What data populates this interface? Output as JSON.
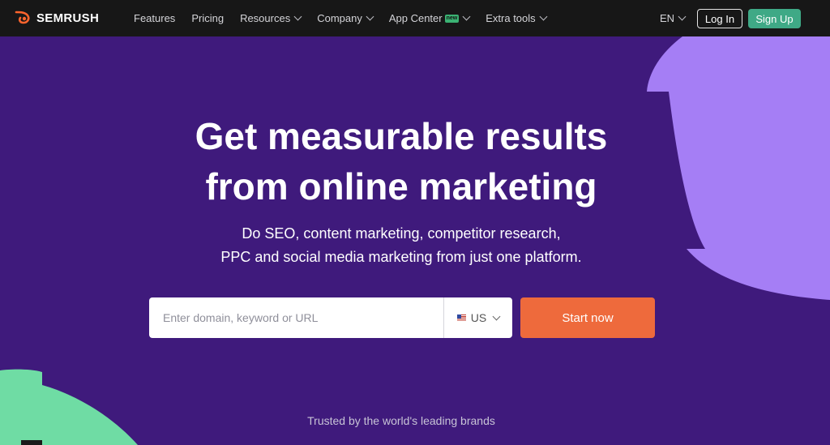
{
  "brand": {
    "name": "SEMRUSH",
    "accent": "#ff642d"
  },
  "nav": {
    "items": [
      {
        "label": "Features",
        "dropdown": false
      },
      {
        "label": "Pricing",
        "dropdown": false
      },
      {
        "label": "Resources",
        "dropdown": true
      },
      {
        "label": "Company",
        "dropdown": true
      },
      {
        "label": "App Center",
        "dropdown": true,
        "badge": "new"
      },
      {
        "label": "Extra tools",
        "dropdown": true
      }
    ],
    "language": "EN",
    "login_label": "Log In",
    "signup_label": "Sign Up"
  },
  "hero": {
    "headline_line1": "Get measurable results",
    "headline_line2": "from online marketing",
    "subhead_line1": "Do SEO, content marketing, competitor research,",
    "subhead_line2": "PPC and social media marketing from just one platform.",
    "search_placeholder": "Enter domain, keyword or URL",
    "country": "US",
    "start_label": "Start now",
    "trusted_text": "Trusted by the world's leading brands"
  },
  "colors": {
    "background": "#3f1a7c",
    "topbar": "#171717",
    "signup": "#3fa986",
    "start_button": "#ee6a3c",
    "deco_purple": "#a57ef5",
    "deco_green": "#6fdca4"
  }
}
